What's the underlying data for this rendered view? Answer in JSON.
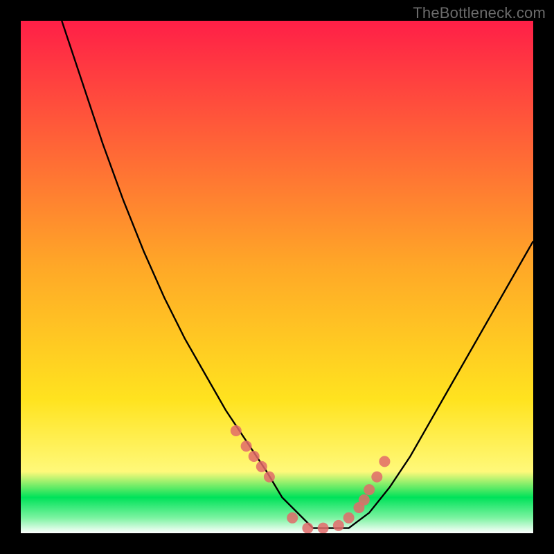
{
  "watermark": "TheBottleneck.com",
  "colors": {
    "background": "#000000",
    "gradient_top": "#ff1f47",
    "gradient_mid": "#ffd21a",
    "gradient_low_green": "#00e25a",
    "gradient_bottom_white": "#ffffff",
    "curve": "#000000",
    "marker": "#e26a6a"
  },
  "chart_data": {
    "type": "line",
    "title": "",
    "xlabel": "",
    "ylabel": "",
    "xlim": [
      0,
      100
    ],
    "ylim": [
      0,
      100
    ],
    "curve_description": "Black V-shaped bottleneck curve overlaid on a vertical red-to-yellow-to-green-to-white gradient background. The curve starts near the top at the left, descends steeply to a broad minimum around the center-right of the horizontal axis, then rises again to roughly 60% height at the right edge. The minimum is where the curve touches the green band near the bottom.",
    "series": [
      {
        "name": "bottleneck-curve",
        "x": [
          8,
          12,
          16,
          20,
          24,
          28,
          32,
          36,
          40,
          44,
          48,
          51,
          54,
          57,
          60,
          64,
          68,
          72,
          76,
          80,
          84,
          88,
          92,
          96,
          100
        ],
        "y": [
          100,
          88,
          76,
          65,
          55,
          46,
          38,
          31,
          24,
          18,
          12,
          7,
          4,
          1,
          1,
          1,
          4,
          9,
          15,
          22,
          29,
          36,
          43,
          50,
          57
        ]
      }
    ],
    "markers": {
      "name": "highlight-points",
      "description": "Salmon circular markers clustered on both flanks of the valley where the curve crosses the yellowish-green band, plus a few on the flat bottom.",
      "x": [
        42,
        44,
        45.5,
        47,
        48.5,
        53,
        56,
        59,
        62,
        64,
        66,
        67,
        68,
        69.5,
        71
      ],
      "y": [
        20,
        17,
        15,
        13,
        11,
        3,
        1,
        1,
        1.5,
        3,
        5,
        6.5,
        8.5,
        11,
        14
      ]
    },
    "gradient_stops_percent_from_top": [
      {
        "pct": 0,
        "color": "#ff1f47"
      },
      {
        "pct": 48,
        "color": "#ffa827"
      },
      {
        "pct": 74,
        "color": "#ffe31f"
      },
      {
        "pct": 88,
        "color": "#fff97a"
      },
      {
        "pct": 93,
        "color": "#00e25a"
      },
      {
        "pct": 97,
        "color": "#7cf3a1"
      },
      {
        "pct": 100,
        "color": "#ffffff"
      }
    ]
  }
}
